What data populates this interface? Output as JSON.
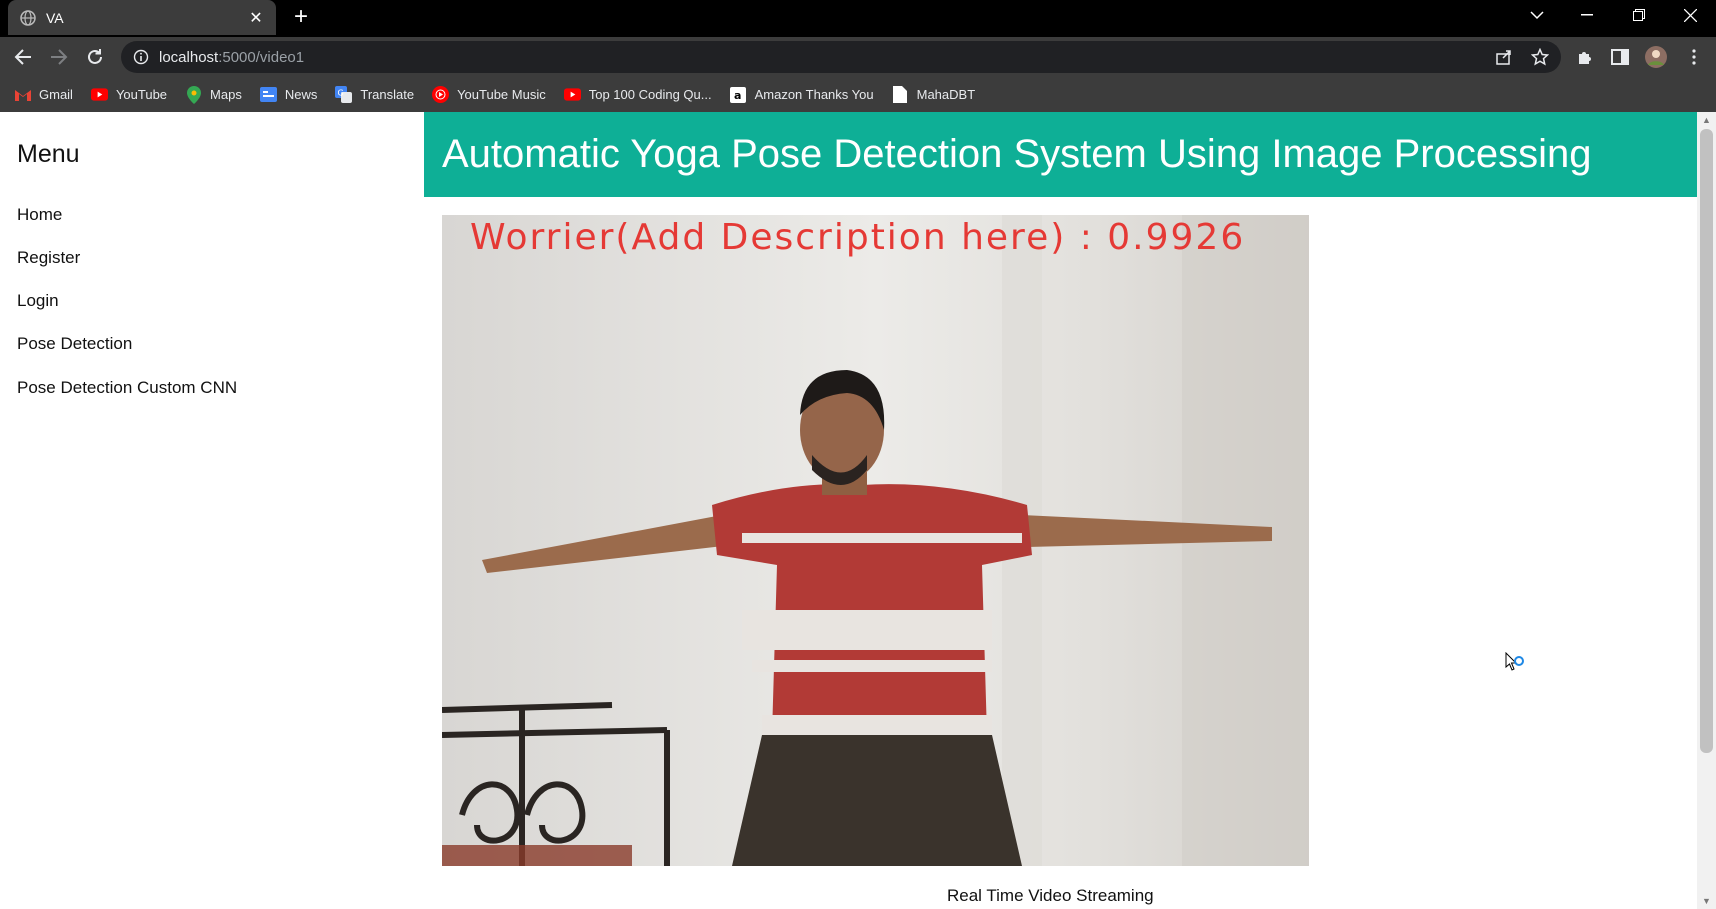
{
  "browser": {
    "tab_title": "VA",
    "url_host": "localhost",
    "url_path": ":5000/video1",
    "bookmarks": [
      {
        "label": "Gmail",
        "icon": "gmail-icon",
        "color": "#ea4335"
      },
      {
        "label": "YouTube",
        "icon": "youtube-icon",
        "color": "#ff0000"
      },
      {
        "label": "Maps",
        "icon": "maps-icon",
        "color": "#34a853"
      },
      {
        "label": "News",
        "icon": "news-icon",
        "color": "#4285f4"
      },
      {
        "label": "Translate",
        "icon": "translate-icon",
        "color": "#4285f4"
      },
      {
        "label": "YouTube Music",
        "icon": "youtube-music-icon",
        "color": "#ff0000"
      },
      {
        "label": "Top 100 Coding Qu...",
        "icon": "youtube-icon",
        "color": "#ff0000"
      },
      {
        "label": "Amazon Thanks You",
        "icon": "amazon-icon",
        "color": "#ffffff"
      },
      {
        "label": "MahaDBT",
        "icon": "page-icon",
        "color": "#ffffff"
      }
    ]
  },
  "sidebar": {
    "title": "Menu",
    "items": [
      {
        "label": "Home"
      },
      {
        "label": "Register"
      },
      {
        "label": "Login"
      },
      {
        "label": "Pose Detection"
      },
      {
        "label": "Pose Detection Custom CNN"
      }
    ]
  },
  "header": {
    "title": "Automatic Yoga Pose Detection System Using Image Processing"
  },
  "video": {
    "overlay_text": "Worrier(Add Description here) : 0.9926",
    "caption": "Real Time Video Streaming"
  },
  "colors": {
    "accent": "#0eaf96",
    "overlay_text": "#e53935"
  }
}
